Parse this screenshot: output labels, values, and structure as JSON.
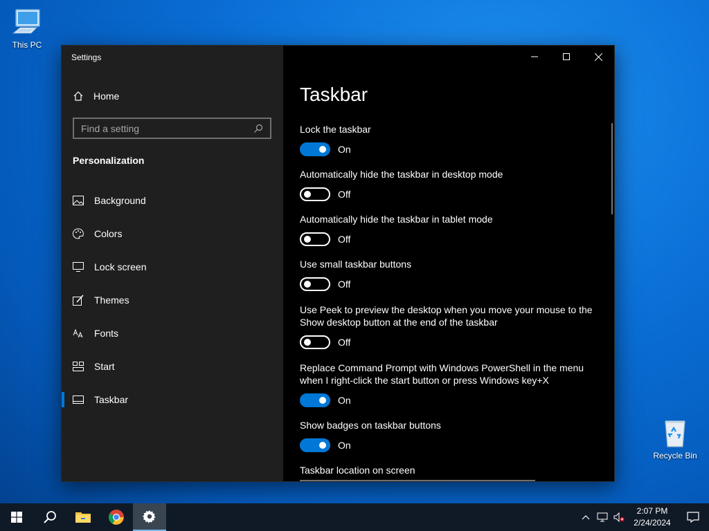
{
  "desktop": {
    "this_pc_label": "This PC",
    "recycle_bin_label": "Recycle Bin"
  },
  "window": {
    "title": "Settings",
    "accent_color": "#0078d7"
  },
  "sidebar": {
    "home_label": "Home",
    "search_placeholder": "Find a setting",
    "section_title": "Personalization",
    "items": [
      {
        "label": "Background",
        "icon": "image-icon"
      },
      {
        "label": "Colors",
        "icon": "palette-icon"
      },
      {
        "label": "Lock screen",
        "icon": "lock-screen-icon"
      },
      {
        "label": "Themes",
        "icon": "brush-icon"
      },
      {
        "label": "Fonts",
        "icon": "font-icon"
      },
      {
        "label": "Start",
        "icon": "start-grid-icon"
      },
      {
        "label": "Taskbar",
        "icon": "taskbar-icon",
        "active": true
      }
    ]
  },
  "main": {
    "title": "Taskbar",
    "options": [
      {
        "label": "Lock the taskbar",
        "state": "On"
      },
      {
        "label": "Automatically hide the taskbar in desktop mode",
        "state": "Off"
      },
      {
        "label": "Automatically hide the taskbar in tablet mode",
        "state": "Off"
      },
      {
        "label": "Use small taskbar buttons",
        "state": "Off"
      },
      {
        "label": "Use Peek to preview the desktop when you move your mouse to the Show desktop button at the end of the taskbar",
        "state": "Off"
      },
      {
        "label": "Replace Command Prompt with Windows PowerShell in the menu when I right-click the start button or press Windows key+X",
        "state": "On"
      },
      {
        "label": "Show badges on taskbar buttons",
        "state": "On"
      }
    ],
    "location_label": "Taskbar location on screen"
  },
  "taskbar": {
    "time": "2:07 PM",
    "date": "2/24/2024",
    "pinned": [
      "start-icon",
      "search-icon",
      "file-explorer-icon",
      "chrome-icon",
      "settings-icon"
    ]
  }
}
